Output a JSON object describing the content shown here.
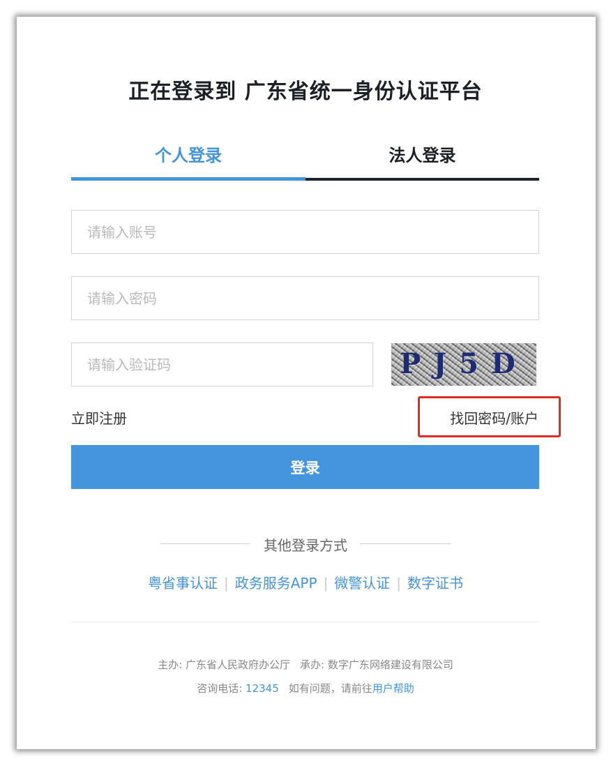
{
  "page": {
    "title": "正在登录到 广东省统一身份认证平台"
  },
  "tabs": [
    {
      "label": "个人登录",
      "active": true
    },
    {
      "label": "法人登录",
      "active": false
    }
  ],
  "form": {
    "account_placeholder": "请输入账号",
    "password_placeholder": "请输入密码",
    "captcha_placeholder": "请输入验证码",
    "captcha_text": "PJ5D",
    "register_label": "立即注册",
    "recover_label": "找回密码/账户",
    "login_label": "登录"
  },
  "other_login": {
    "title": "其他登录方式",
    "methods": [
      "粤省事认证",
      "政务服务APP",
      "微警认证",
      "数字证书"
    ],
    "separator": "|"
  },
  "footer": {
    "host_label": "主办: 广东省人民政府办公厅",
    "undertaker_label": "承办: 数字广东网络建设有限公司",
    "hotline_label": "咨询电话: ",
    "hotline_number": "12345",
    "help_prefix": "如有问题，请前往",
    "help_link": "用户帮助"
  },
  "colors": {
    "accent": "#4394da",
    "highlight_box": "#e02b20",
    "title": "#1b1f26"
  }
}
